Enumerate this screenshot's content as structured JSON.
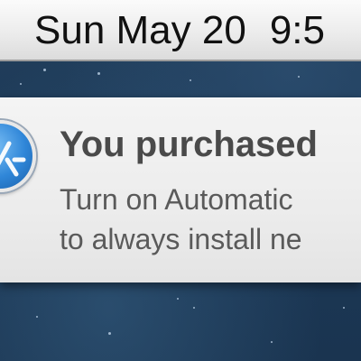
{
  "menubar": {
    "date": "Sun May 20",
    "time": "9:5"
  },
  "notification": {
    "app_icon": "app-store-icon",
    "title": "You purchased",
    "body_line1": "Turn on Automatic",
    "body_line2": "to always install ne"
  },
  "colors": {
    "desktop": "#1d3a58",
    "menubar": "#ececec",
    "notification_bg": "#ececec",
    "title_text": "#4a4a4a",
    "body_text": "#5a5a5a",
    "icon_blue": "#2f86d8"
  }
}
